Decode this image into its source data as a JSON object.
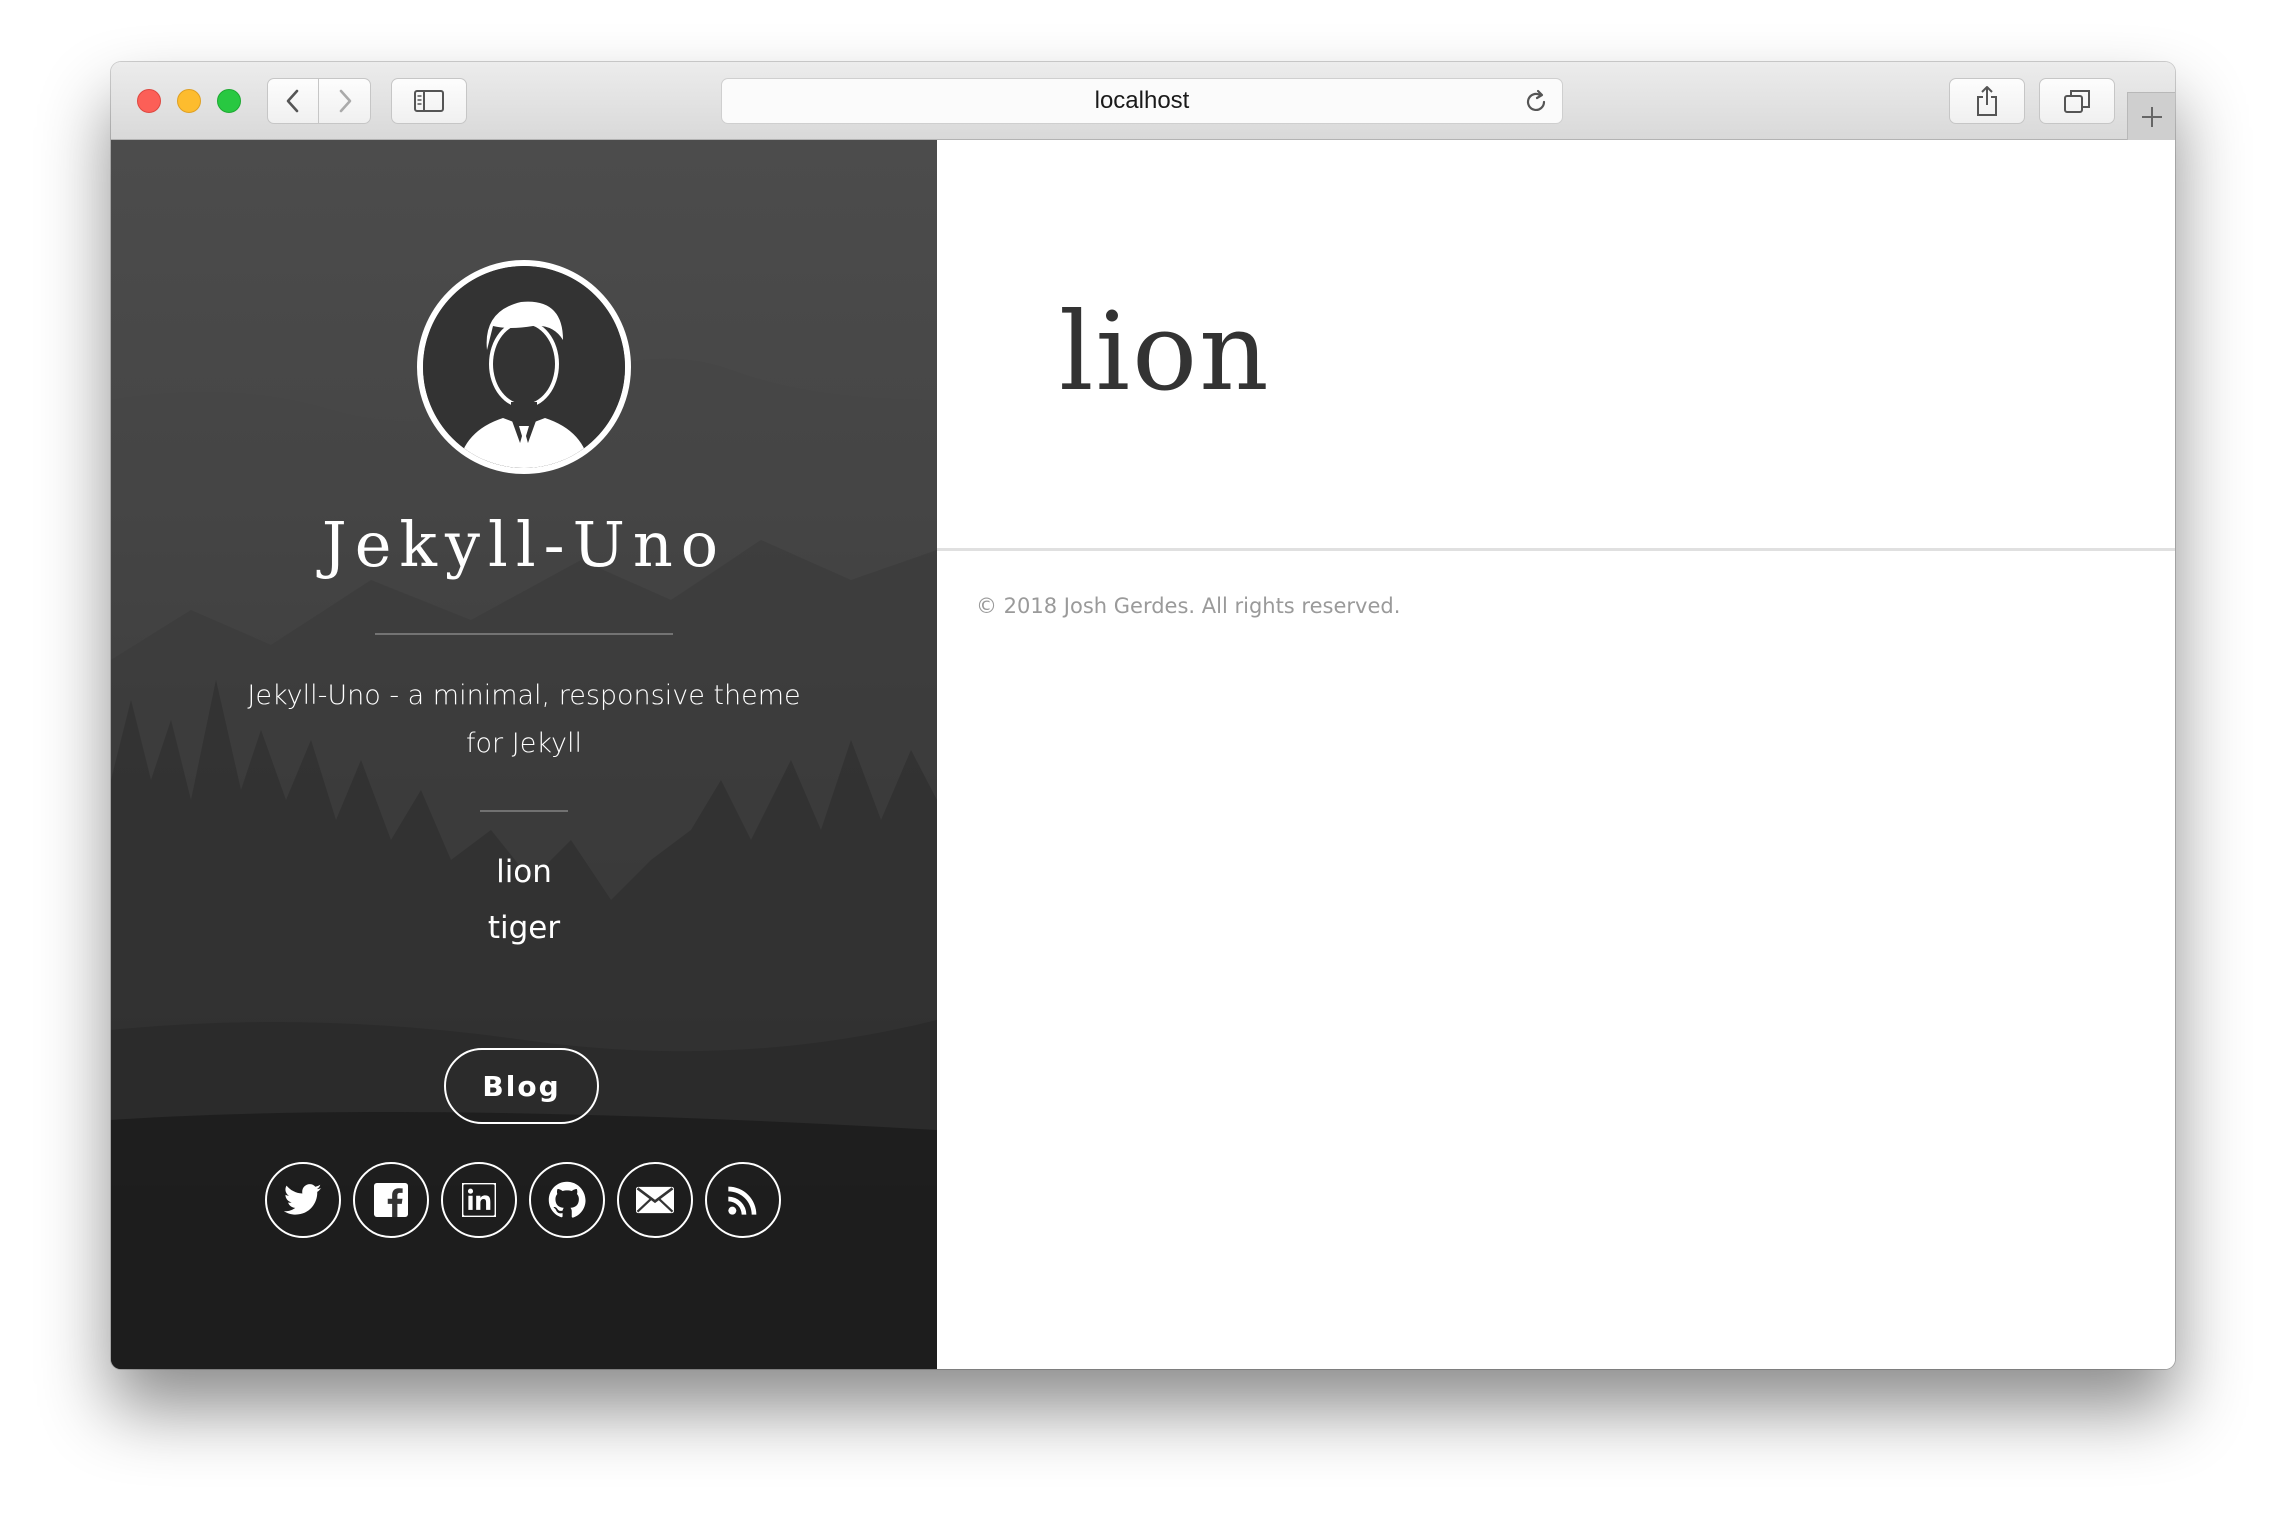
{
  "browser": {
    "url": "localhost",
    "icons": [
      "back-icon",
      "forward-icon",
      "sidebar-icon",
      "reload-icon",
      "share-icon",
      "tabs-icon",
      "plus-icon"
    ]
  },
  "sidebar": {
    "site_title": "Jekyll-Uno",
    "tagline": "Jekyll-Uno - a minimal, responsive theme for Jekyll",
    "nav": [
      "lion",
      "tiger"
    ],
    "blog_button": "Blog",
    "social_icons": [
      "twitter-icon",
      "facebook-icon",
      "linkedin-icon",
      "github-icon",
      "email-icon",
      "rss-icon"
    ]
  },
  "main": {
    "heading": "lion",
    "footer": "© 2018 Josh Gerdes. All rights reserved."
  },
  "colors": {
    "close": "#fc5f57",
    "minimize": "#fdbc2e",
    "maximize": "#28c841",
    "heading": "#333333",
    "footer": "#9a9a9a"
  }
}
